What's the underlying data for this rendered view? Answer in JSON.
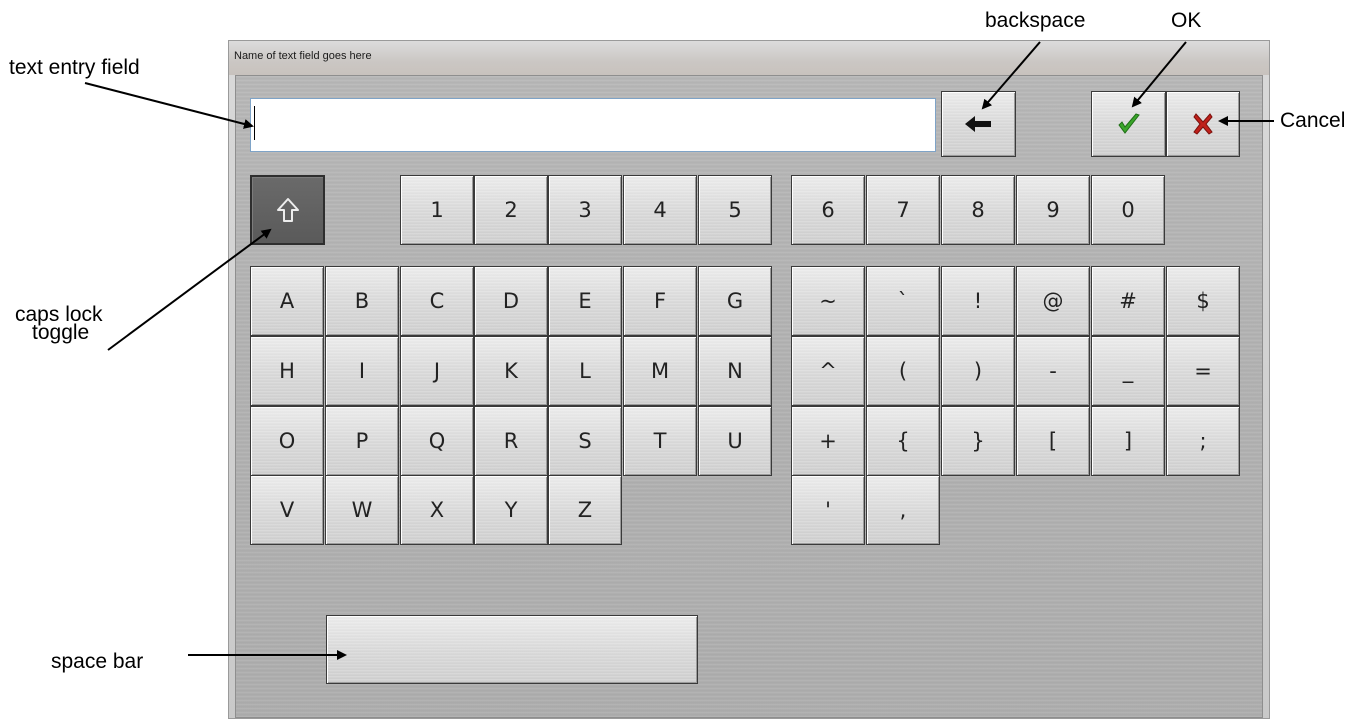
{
  "annotations": {
    "text_entry_field": "text entry field",
    "backspace": "backspace",
    "ok": "OK",
    "cancel": "Cancel",
    "caps_lock_line1": "caps lock",
    "caps_lock_line2": "toggle",
    "space_bar": "space bar"
  },
  "window": {
    "title": "Name of text field goes here"
  },
  "text_field": {
    "value": "",
    "placeholder": ""
  },
  "buttons": {
    "backspace_icon": "left-arrow-icon",
    "ok_icon": "green-check-icon",
    "cancel_icon": "red-x-icon",
    "caps_icon": "shift-arrow-icon"
  },
  "numbers": [
    "1",
    "2",
    "3",
    "4",
    "5",
    "6",
    "7",
    "8",
    "9",
    "0"
  ],
  "letters": {
    "row1": [
      "A",
      "B",
      "C",
      "D",
      "E",
      "F",
      "G"
    ],
    "row2": [
      "H",
      "I",
      "J",
      "K",
      "L",
      "M",
      "N"
    ],
    "row3": [
      "O",
      "P",
      "Q",
      "R",
      "S",
      "T",
      "U"
    ],
    "row4": [
      "V",
      "W",
      "X",
      "Y",
      "Z"
    ]
  },
  "symbols": {
    "row1": [
      "~",
      "`",
      "!",
      "@",
      "#",
      "$"
    ],
    "row2": [
      "^",
      "(",
      ")",
      "-",
      "_",
      "="
    ],
    "row3": [
      "+",
      "{",
      "}",
      "[",
      "]",
      ";"
    ],
    "row4": [
      "'",
      ","
    ]
  },
  "colors": {
    "ok_check": "#3aa52a",
    "cancel_x": "#c0201a",
    "caps_key": "#5f5f5f"
  }
}
